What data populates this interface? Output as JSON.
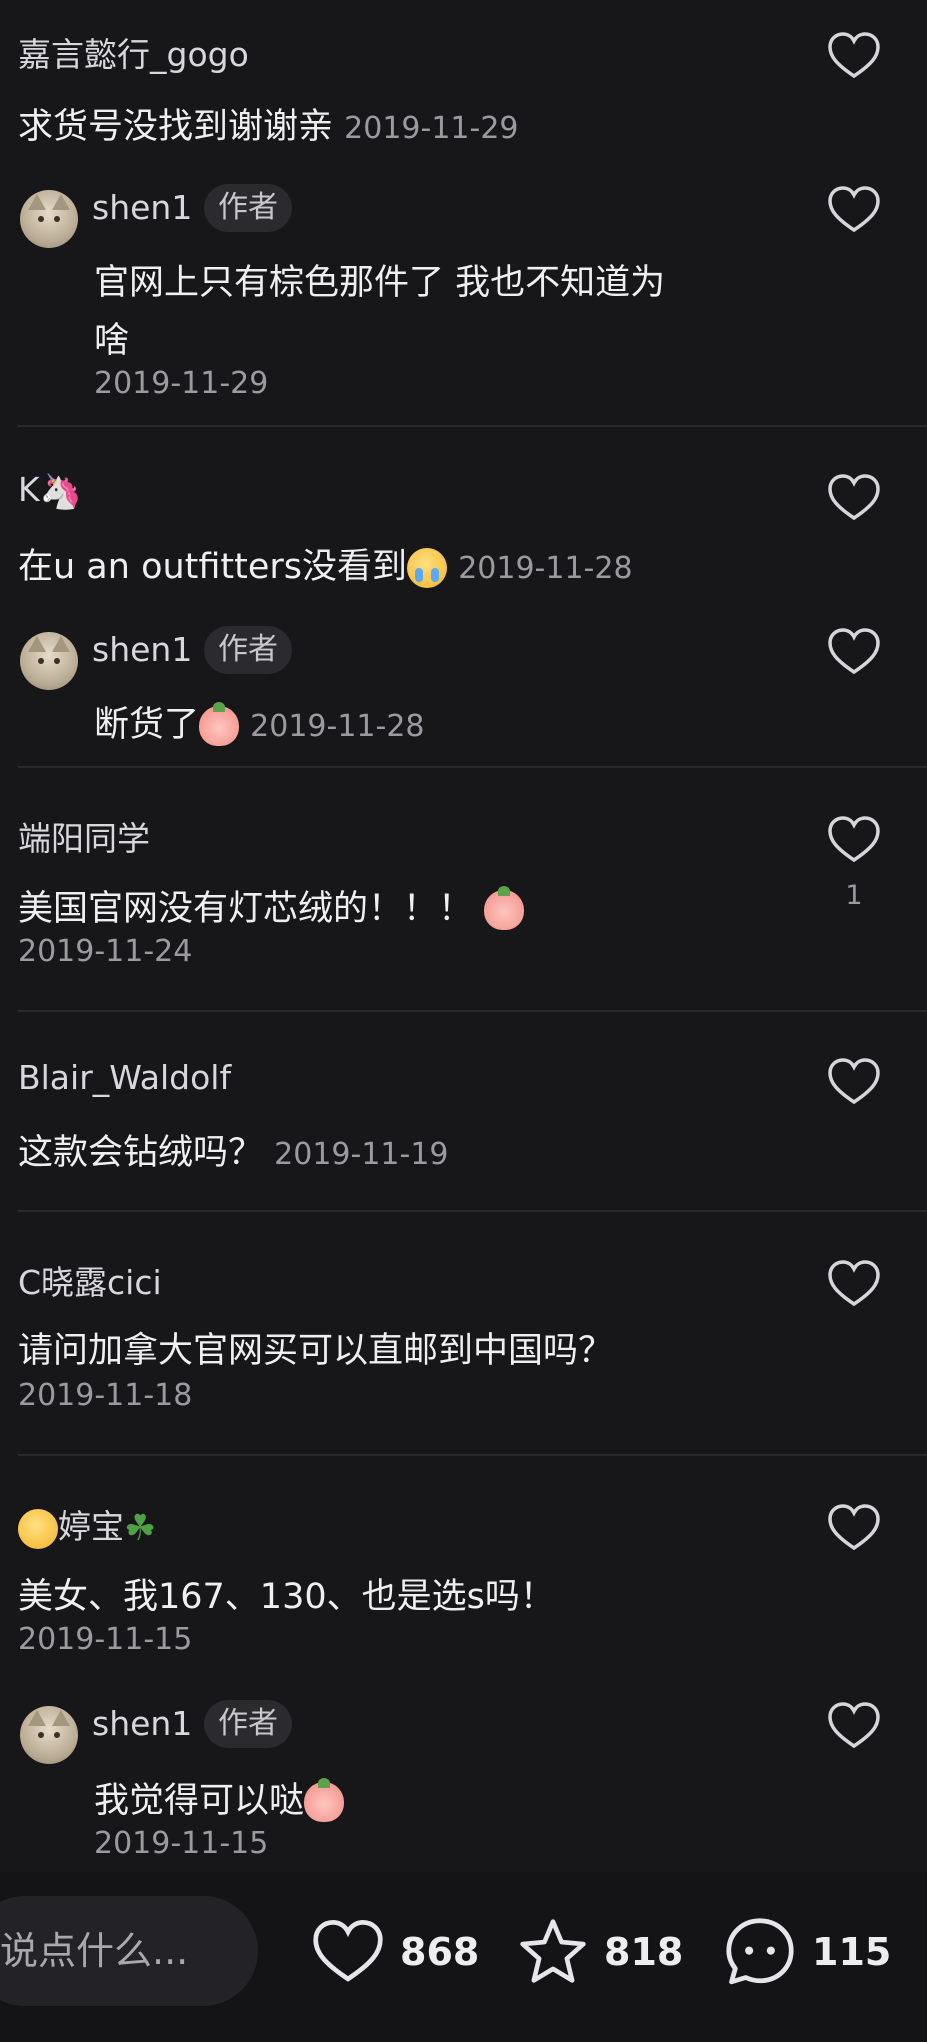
{
  "threads": [
    {
      "comment": {
        "user": "嘉言懿行_gogo",
        "text": "求货号没找到谢谢亲",
        "date": "2019-11-29"
      },
      "reply": {
        "user": "shen1",
        "badge": "作者",
        "text": "官网上只有棕色那件了 我也不知道为",
        "text2": "啥",
        "date": "2019-11-29"
      }
    },
    {
      "comment": {
        "user": "K",
        "user_emoji": "unicorn-icon",
        "text": "在u an outfitters没看到",
        "text_emoji": "crying-face-icon",
        "date": "2019-11-28"
      },
      "reply": {
        "user": "shen1",
        "badge": "作者",
        "text": "断货了",
        "text_emoji": "peach-face-icon",
        "date": "2019-11-28"
      }
    },
    {
      "comment": {
        "user": "端阳同学",
        "text": "美国官网没有灯芯绒的！！！",
        "text_emoji": "peach-face-icon",
        "date": "2019-11-24",
        "likes": "1"
      }
    },
    {
      "comment": {
        "user": "Blair_Waldolf",
        "text": "这款会钻绒吗？",
        "date": "2019-11-19"
      }
    },
    {
      "comment": {
        "user": "C晓露cici",
        "text": "请问加拿大官网买可以直邮到中国吗？",
        "date": "2019-11-18"
      }
    },
    {
      "comment": {
        "user": "婷宝",
        "user_emoji_before": "kiss-face-icon",
        "user_emoji_after": "clover-icon",
        "text": "美女、我167、130、也是选s吗！",
        "date": "2019-11-15"
      },
      "reply": {
        "user": "shen1",
        "badge": "作者",
        "text": "我觉得可以哒",
        "text_emoji": "peach-face-icon",
        "date": "2019-11-15"
      }
    }
  ],
  "bottom_bar": {
    "input_placeholder": "说点什么...",
    "likes": "868",
    "favorites": "818",
    "comments": "115"
  },
  "colors": {
    "background": "#17171a",
    "text": "#efeff1",
    "muted": "#9a9aa0"
  }
}
